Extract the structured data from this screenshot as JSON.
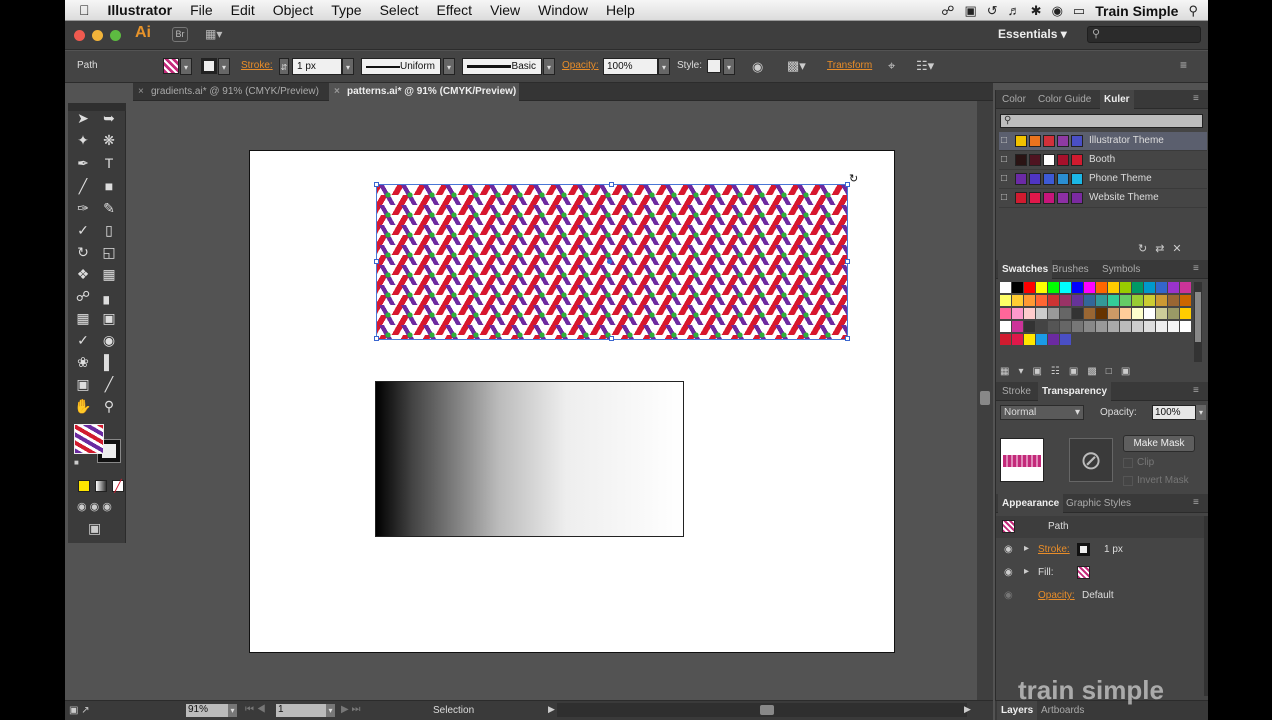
{
  "menubar": {
    "app": "Illustrator",
    "items": [
      "File",
      "Edit",
      "Object",
      "Type",
      "Select",
      "Effect",
      "View",
      "Window",
      "Help"
    ],
    "user": "Train Simple"
  },
  "appbar": {
    "logo": "Ai",
    "bridge": "Br",
    "workspace": "Essentials",
    "search_placeholder": ""
  },
  "controlbar": {
    "selection": "Path",
    "stroke_label": "Stroke:",
    "stroke_weight": "1 px",
    "profile_uniform": "Uniform",
    "brush_basic": "Basic",
    "opacity_label": "Opacity:",
    "opacity_value": "100%",
    "style_label": "Style:",
    "transform_label": "Transform"
  },
  "tabs": [
    {
      "label": "gradients.ai* @ 91% (CMYK/Preview)"
    },
    {
      "label": "patterns.ai* @ 91% (CMYK/Preview)"
    }
  ],
  "color_panel": {
    "tabs": [
      "Color",
      "Color Guide",
      "Kuler"
    ],
    "themes": [
      {
        "name": "Illustrator Theme",
        "colors": [
          "#f2c200",
          "#e9731e",
          "#d1303a",
          "#8e3aa3",
          "#4a4fc5"
        ]
      },
      {
        "name": "Booth",
        "colors": [
          "#2a1414",
          "#4f1320",
          "#ffffff",
          "#a7102b",
          "#d11b2f"
        ]
      },
      {
        "name": "Phone Theme",
        "colors": [
          "#6b2aa6",
          "#4f35c4",
          "#3d5ad6",
          "#2a8ed2",
          "#1bb7e6"
        ]
      },
      {
        "name": "Website Theme",
        "colors": [
          "#d11b2f",
          "#e0184a",
          "#c7157a",
          "#8c2fa4",
          "#7a2aa0"
        ]
      }
    ]
  },
  "swatches_panel": {
    "tabs": [
      "Swatches",
      "Brushes",
      "Symbols"
    ]
  },
  "transparency_panel": {
    "tabs": [
      "Stroke",
      "Transparency"
    ],
    "blend_mode": "Normal",
    "opacity_label": "Opacity:",
    "opacity_value": "100%",
    "make_mask": "Make Mask",
    "clip": "Clip",
    "invert_mask": "Invert Mask"
  },
  "appearance_panel": {
    "tabs": [
      "Appearance",
      "Graphic Styles"
    ],
    "title": "Path",
    "stroke_label": "Stroke:",
    "stroke_value": "1 px",
    "fill_label": "Fill:",
    "opacity_label": "Opacity:",
    "opacity_value": "Default"
  },
  "statusbar": {
    "zoom": "91%",
    "artboard": "1",
    "tool": "Selection"
  },
  "bottom_panel": {
    "tabs": [
      "Layers",
      "Artboards"
    ],
    "watermark": "train simple"
  }
}
